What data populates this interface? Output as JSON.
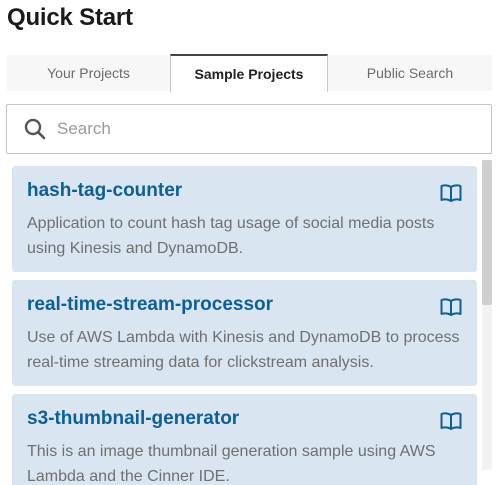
{
  "title": "Quick Start",
  "tabs": [
    {
      "label": "Your Projects"
    },
    {
      "label": "Sample Projects"
    },
    {
      "label": "Public Search"
    }
  ],
  "search": {
    "placeholder": "Search",
    "value": ""
  },
  "projects": [
    {
      "name": "hash-tag-counter",
      "description": "Application to count hash tag usage of social media posts using Kinesis and DynamoDB."
    },
    {
      "name": "real-time-stream-processor",
      "description": "Use of AWS Lambda with Kinesis and DynamoDB to process real-time streaming data for clickstream analysis."
    },
    {
      "name": "s3-thumbnail-generator",
      "description": "This is an image thumbnail generation sample using AWS Lambda and the Cinner IDE."
    }
  ],
  "colors": {
    "card_bg": "#d9e6f2",
    "card_title": "#0e5f96",
    "book_icon": "#0e5f96"
  },
  "icons": {
    "search": "search-icon",
    "book": "book-icon"
  }
}
